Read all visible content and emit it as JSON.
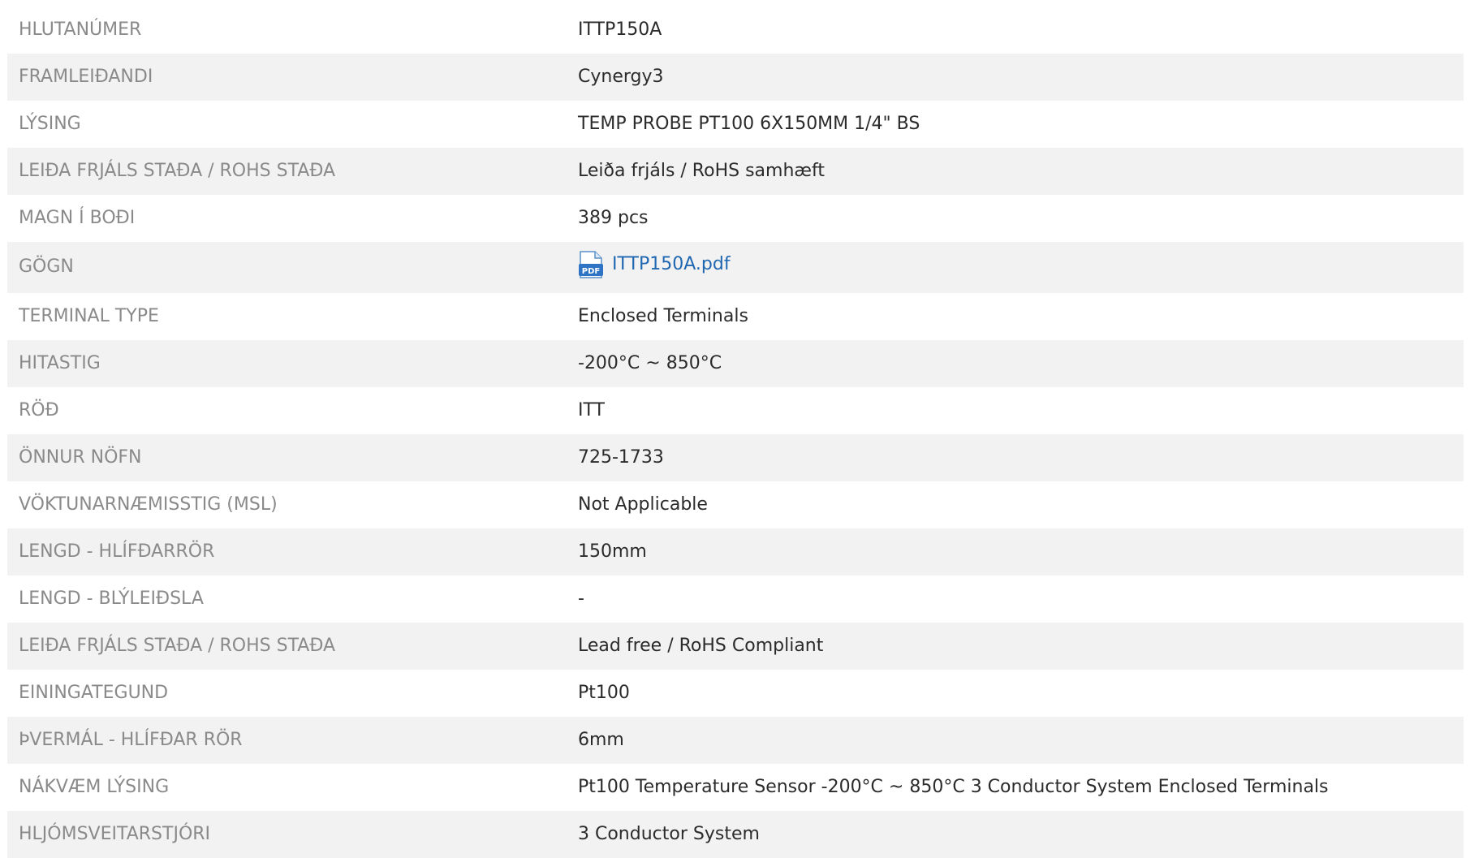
{
  "spec_rows": [
    {
      "label": "HLUTANÚMER",
      "value": "ITTP150A"
    },
    {
      "label": "FRAMLEIÐANDI",
      "value": "Cynergy3"
    },
    {
      "label": "LÝSING",
      "value": "TEMP PROBE PT100 6X150MM 1/4\" BS"
    },
    {
      "label": "LEIÐA FRJÁLS STAÐA / ROHS STAÐA",
      "value": "Leiða frjáls / RoHS samhæft"
    },
    {
      "label": "MAGN Í BOÐI",
      "value": "389 pcs"
    },
    {
      "label": "GÖGN",
      "value": "ITTP150A.pdf",
      "icon": "pdf-file-icon",
      "link_color": "#1f67b1"
    },
    {
      "label": "TERMINAL TYPE",
      "value": "Enclosed Terminals"
    },
    {
      "label": "HITASTIG",
      "value": "-200°C ~ 850°C"
    },
    {
      "label": "RÖÐ",
      "value": "ITT"
    },
    {
      "label": "ÖNNUR NÖFN",
      "value": "725-1733"
    },
    {
      "label": "VÖKTUNARNÆMISSTIG (MSL)",
      "value": "Not Applicable"
    },
    {
      "label": "LENGD - HLÍFÐARRÖR",
      "value": "150mm"
    },
    {
      "label": "LENGD - BLÝLEIÐSLA",
      "value": "-"
    },
    {
      "label": "LEIÐA FRJÁLS STAÐA / ROHS STAÐA",
      "value": "Lead free / RoHS Compliant"
    },
    {
      "label": "EININGATEGUND",
      "value": "Pt100"
    },
    {
      "label": "ÞVERMÁL - HLÍFÐAR RÖR",
      "value": "6mm"
    },
    {
      "label": "NÁKVÆM LÝSING",
      "value": "Pt100 Temperature Sensor -200°C ~ 850°C 3 Conductor System Enclosed Terminals"
    },
    {
      "label": "HLJÓMSVEITARSTJÓRI",
      "value": "3 Conductor System"
    }
  ]
}
